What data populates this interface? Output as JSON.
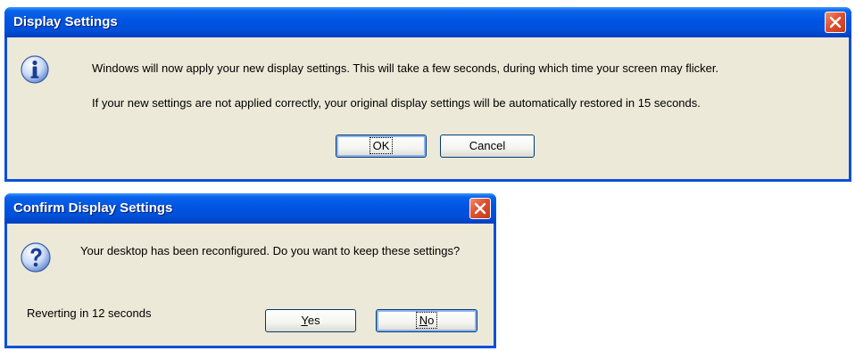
{
  "dialog1": {
    "title": "Display Settings",
    "message_line1": "Windows will now apply your new display settings.  This will take a few seconds, during which time your screen may flicker.",
    "message_line2": "If your new settings are not applied correctly, your original display settings will be automatically restored in 15 seconds.",
    "ok_label": "OK",
    "cancel_label": "Cancel",
    "icon": "information-icon"
  },
  "dialog2": {
    "title": "Confirm Display Settings",
    "message": "Your desktop has been reconfigured. Do you want to keep these settings?",
    "countdown": "Reverting in 12 seconds",
    "yes_accel": "Y",
    "yes_rest": "es",
    "no_accel": "N",
    "no_rest": "o",
    "icon": "question-icon"
  },
  "colors": {
    "titlebar": "#0054e3",
    "dialog_bg": "#ece9d8",
    "close_button": "#e05030",
    "border": "#0a50d8"
  }
}
